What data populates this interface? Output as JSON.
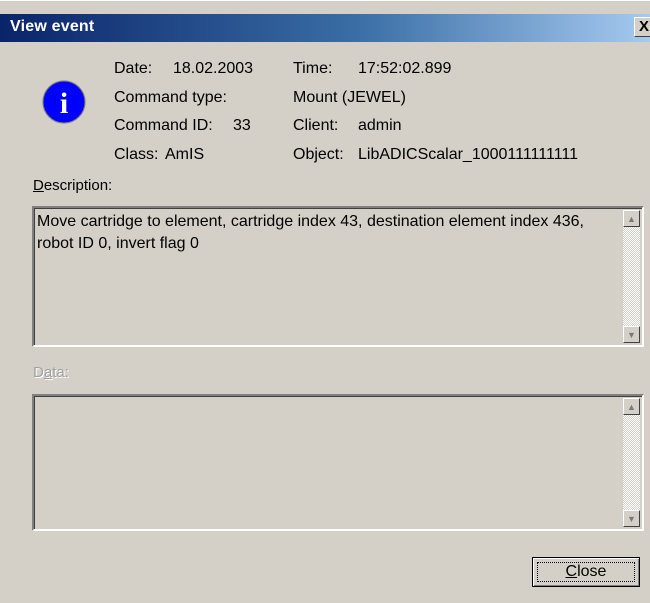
{
  "window": {
    "title": "View event",
    "close_glyph": "X"
  },
  "icon": {
    "name": "info-icon",
    "glyph": "i",
    "color": "#0000ff"
  },
  "fields": {
    "date_label": "Date:",
    "date_value": "18.02.2003",
    "time_label": "Time:",
    "time_value": "17:52:02.899",
    "command_type_label": "Command type:",
    "command_type_value": "Mount (JEWEL)",
    "command_id_label": "Command ID:",
    "command_id_value": "33",
    "client_label": "Client:",
    "client_value": "admin",
    "class_label": "Class:",
    "class_value": "AmIS",
    "object_label": "Object:",
    "object_value": "LibADICScalar_1000111111111"
  },
  "description": {
    "label_first": "D",
    "label_rest": "escription:",
    "text": "Move cartridge to element, cartridge index 43, destination element index 436, robot ID 0, invert flag 0"
  },
  "data_section": {
    "label_first": "D",
    "label_mid": "a",
    "label_rest": "ta:",
    "text": ""
  },
  "buttons": {
    "close_first": "C",
    "close_rest": "lose"
  },
  "colors": {
    "title_start": "#0a246a",
    "title_end": "#a6caf0",
    "face": "#d4d0c8"
  }
}
